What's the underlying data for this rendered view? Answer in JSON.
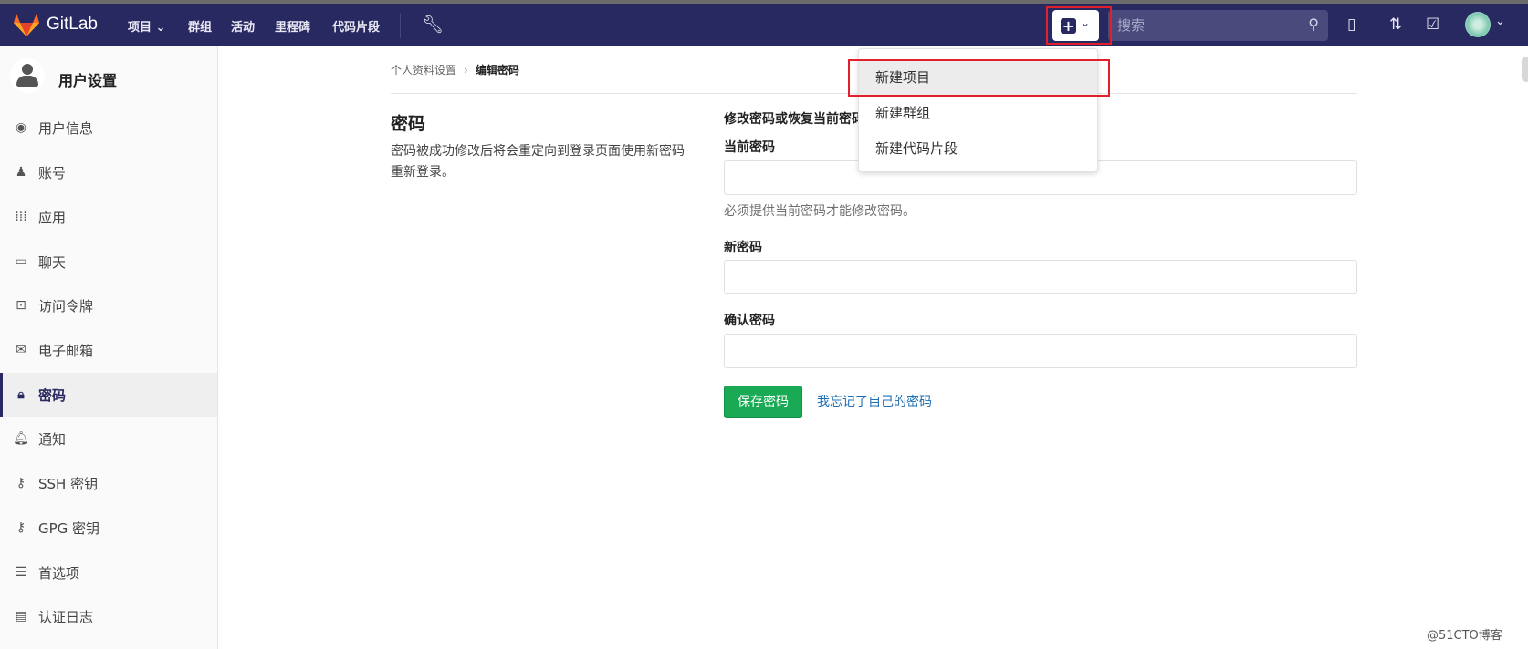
{
  "navbar": {
    "brand": "GitLab",
    "items": [
      "项目",
      "群组",
      "活动",
      "里程碑",
      "代码片段"
    ],
    "projects_chevron": "chevron-down",
    "search_placeholder": "搜索",
    "bg_color": "#292961"
  },
  "new_menu": {
    "items": [
      "新建项目",
      "新建群组",
      "新建代码片段"
    ]
  },
  "sidebar": {
    "title": "用户设置",
    "items": [
      {
        "label": "用户信息",
        "icon": "profile-icon"
      },
      {
        "label": "账号",
        "icon": "account-icon"
      },
      {
        "label": "应用",
        "icon": "applications-icon"
      },
      {
        "label": "聊天",
        "icon": "chat-icon"
      },
      {
        "label": "访问令牌",
        "icon": "token-icon"
      },
      {
        "label": "电子邮箱",
        "icon": "mail-icon"
      },
      {
        "label": "密码",
        "icon": "lock-icon",
        "active": true
      },
      {
        "label": "通知",
        "icon": "bell-icon"
      },
      {
        "label": "SSH 密钥",
        "icon": "key-icon"
      },
      {
        "label": "GPG 密钥",
        "icon": "key-icon"
      },
      {
        "label": "首选项",
        "icon": "preferences-icon"
      },
      {
        "label": "认证日志",
        "icon": "log-icon"
      }
    ]
  },
  "breadcrumb": {
    "parent": "个人资料设置",
    "current": "编辑密码"
  },
  "section": {
    "title": "密码",
    "description": "密码被成功修改后将会重定向到登录页面使用新密码重新登录。"
  },
  "form": {
    "heading": "修改密码或恢复当前密码",
    "current_label": "当前密码",
    "current_value": "",
    "current_help": "必须提供当前密码才能修改密码。",
    "new_label": "新密码",
    "new_value": "",
    "confirm_label": "确认密码",
    "confirm_value": "",
    "save_label": "保存密码",
    "forgot_label": "我忘记了自己的密码"
  },
  "watermark": "@51CTO博客"
}
